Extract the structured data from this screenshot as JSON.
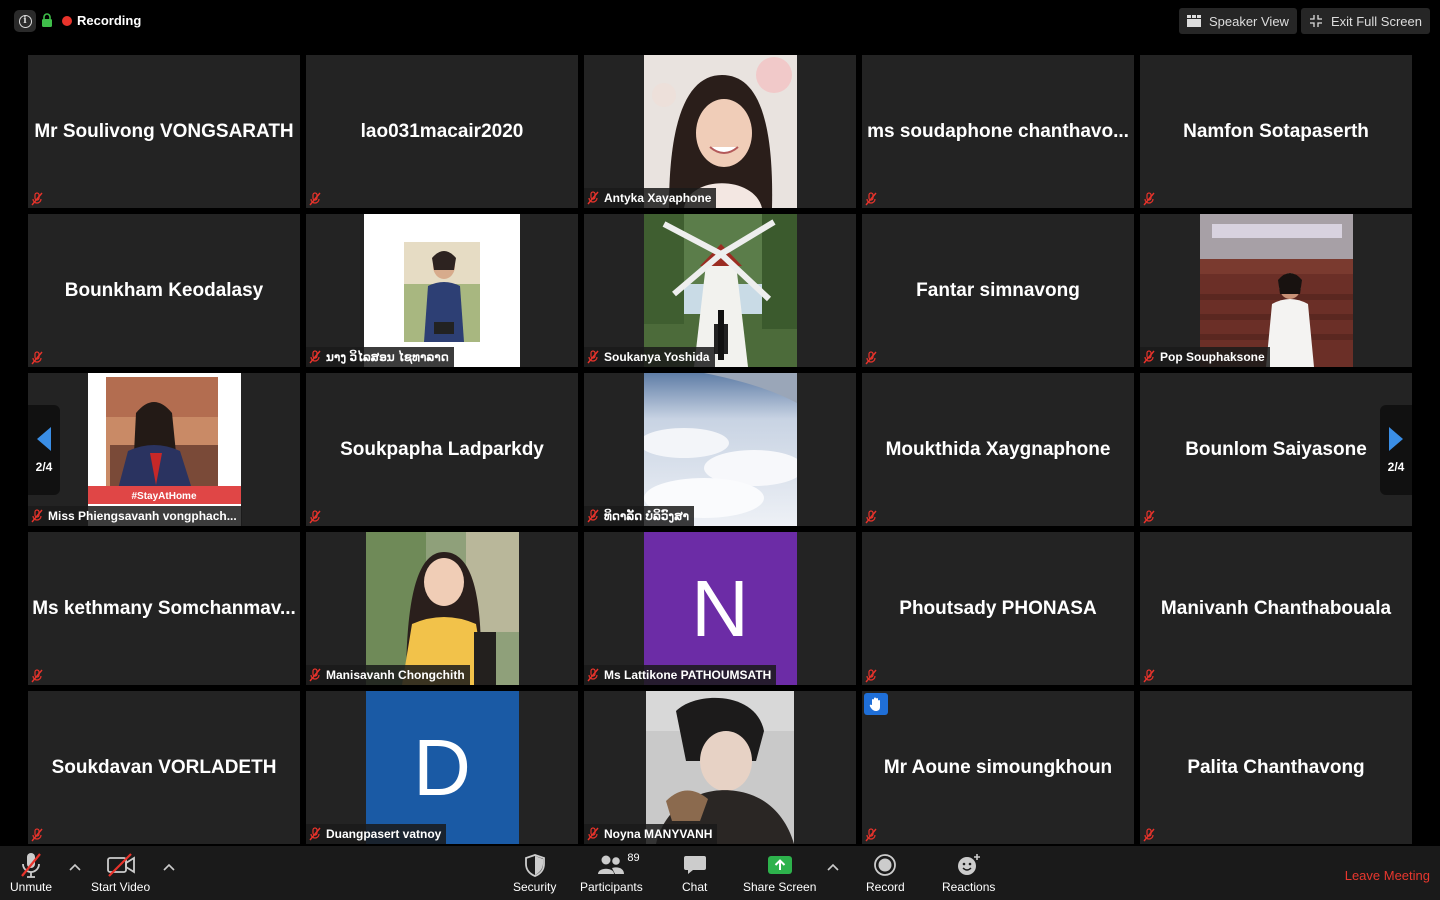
{
  "topbar": {
    "recording_label": "Recording",
    "speaker_view_label": "Speaker View",
    "exit_fullscreen_label": "Exit Full Screen"
  },
  "pager": {
    "left_label": "2/4",
    "right_label": "2/4"
  },
  "colors": {
    "recording": "#e8332b",
    "mute": "#e8332b",
    "leave": "#e8372e",
    "share": "#2db24c",
    "raise_hand": "#1f6fd8",
    "tile_bg": "#232323"
  },
  "tiles": [
    {
      "name": "Mr Soulivong VONGSARATH",
      "video": false
    },
    {
      "name": "lao031macair2020",
      "video": false
    },
    {
      "name": "Antyka Xayaphone",
      "video": true,
      "video_kind": "portrait-woman-smiling"
    },
    {
      "name": "ms soudaphone chanthavo...",
      "video": false
    },
    {
      "name": "Namfon Sotapaserth",
      "video": false
    },
    {
      "name": "Bounkham Keodalasy",
      "video": false
    },
    {
      "name": "ນາງ ວິໄລສອນ ໄຊທາລາດ",
      "video": true,
      "video_kind": "woman-uniform-white-bg"
    },
    {
      "name": "Soukanya Yoshida",
      "video": true,
      "video_kind": "windmill"
    },
    {
      "name": "Fantar simnavong",
      "video": false
    },
    {
      "name": "Pop Souphaksone",
      "video": true,
      "video_kind": "woman-hall"
    },
    {
      "name": "Miss Phiengsavanh vongphach...",
      "video": true,
      "video_kind": "woman-stay-at-home",
      "banner": "#StayAtHome"
    },
    {
      "name": "Soukpapha Ladparkdy",
      "video": false
    },
    {
      "name": "ທິດາລັດ ບໍລິວົງສາ",
      "video": true,
      "video_kind": "clouds"
    },
    {
      "name": "Moukthida Xaygnaphone",
      "video": false
    },
    {
      "name": "Bounlom Saiyasone",
      "video": false
    },
    {
      "name": "Ms kethmany Somchanmav...",
      "video": false
    },
    {
      "name": "Manisavanh Chongchith",
      "video": true,
      "video_kind": "woman-yellow-shirt"
    },
    {
      "name": "Ms Lattikone PATHOUMSATH",
      "video": true,
      "video_kind": "letter",
      "letter": "N",
      "letter_bg": "#6c2ca6"
    },
    {
      "name": "Phoutsady PHONASA",
      "video": false
    },
    {
      "name": "Manivanh Chanthabouala",
      "video": false
    },
    {
      "name": "Soukdavan VORLADETH",
      "video": false
    },
    {
      "name": "Duangpasert vatnoy",
      "video": true,
      "video_kind": "letter",
      "letter": "D",
      "letter_bg": "#1a5aa5"
    },
    {
      "name": "Noyna MANYVANH",
      "video": true,
      "video_kind": "man-portrait"
    },
    {
      "name": "Mr Aoune simoungkhoun",
      "video": false,
      "raised_hand": true
    },
    {
      "name": "Palita Chanthavong",
      "video": false
    }
  ],
  "toolbar": {
    "unmute": "Unmute",
    "start_video": "Start Video",
    "security": "Security",
    "participants": "Participants",
    "participants_count": "89",
    "chat": "Chat",
    "share_screen": "Share Screen",
    "record": "Record",
    "reactions": "Reactions",
    "leave": "Leave Meeting"
  }
}
